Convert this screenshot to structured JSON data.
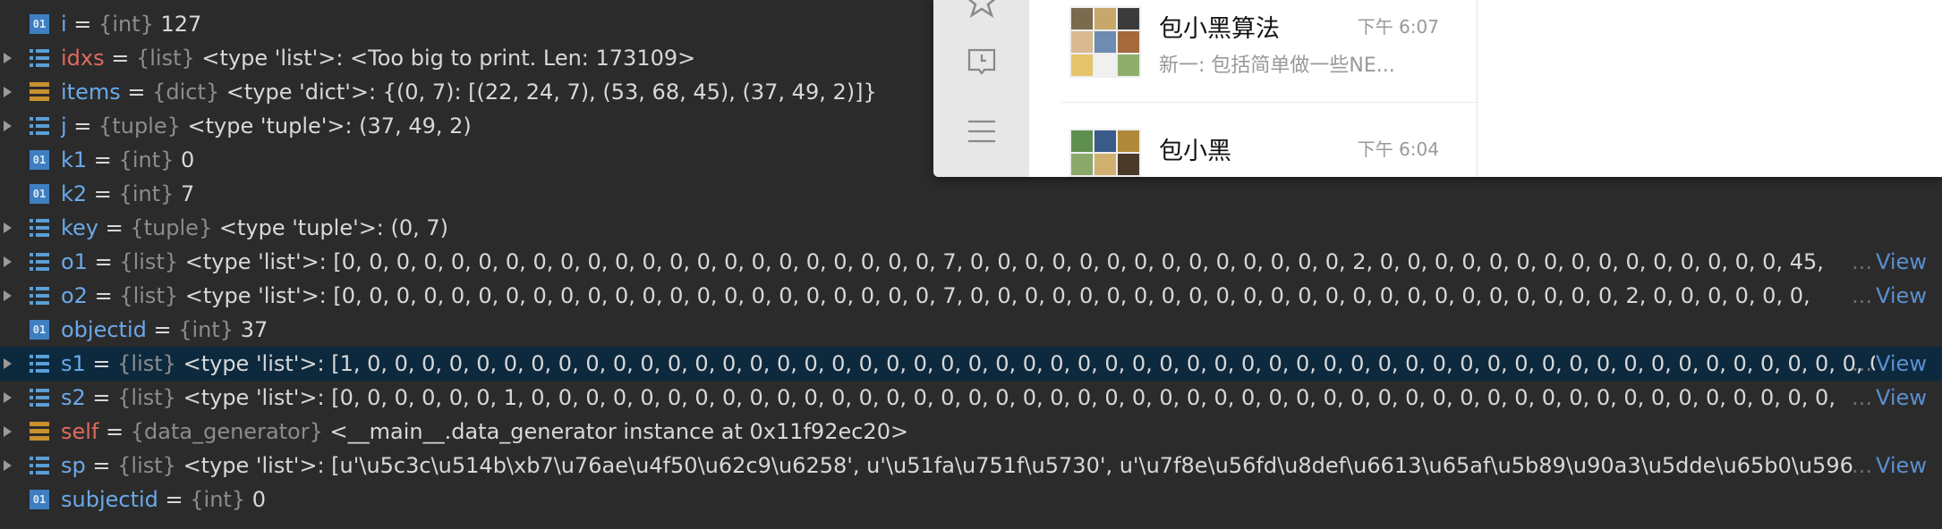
{
  "colors": {
    "background": "#2b2b2b",
    "selected_row": "#0d293e",
    "var_blue": "#6aa9e9",
    "var_red": "#e06a5f",
    "type_gray": "#8c8c8c",
    "value_text": "#d8d8d8",
    "view_link": "#5a8fd0"
  },
  "variables": [
    {
      "icon": "int-icon",
      "expandable": false,
      "name": "i",
      "name_color": "blue",
      "type": "{int}",
      "value": "127",
      "ellipsis": "",
      "view": ""
    },
    {
      "icon": "list-icon",
      "expandable": true,
      "name": "idxs",
      "name_color": "red",
      "type": "{list}",
      "value": "<type 'list'>: <Too big to print. Len: 173109>",
      "ellipsis": "",
      "view": ""
    },
    {
      "icon": "dict-icon",
      "expandable": true,
      "name": "items",
      "name_color": "blue",
      "type": "{dict}",
      "value": "<type 'dict'>: {(0, 7): [(22, 24, 7), (53, 68, 45), (37, 49, 2)]}",
      "ellipsis": "",
      "view": ""
    },
    {
      "icon": "list-icon",
      "expandable": true,
      "name": "j",
      "name_color": "blue",
      "type": "{tuple}",
      "value": "<type 'tuple'>: (37, 49, 2)",
      "ellipsis": "",
      "view": ""
    },
    {
      "icon": "int-icon",
      "expandable": false,
      "name": "k1",
      "name_color": "blue",
      "type": "{int}",
      "value": "0",
      "ellipsis": "",
      "view": ""
    },
    {
      "icon": "int-icon",
      "expandable": false,
      "name": "k2",
      "name_color": "blue",
      "type": "{int}",
      "value": "7",
      "ellipsis": "",
      "view": ""
    },
    {
      "icon": "list-icon",
      "expandable": true,
      "name": "key",
      "name_color": "blue",
      "type": "{tuple}",
      "value": "<type 'tuple'>: (0, 7)",
      "ellipsis": "",
      "view": ""
    },
    {
      "icon": "list-icon",
      "expandable": true,
      "name": "o1",
      "name_color": "blue",
      "type": "{list}",
      "value": "<type 'list'>: [0, 0, 0, 0, 0, 0, 0, 0, 0, 0, 0, 0, 0, 0, 0, 0, 0, 0, 0, 0, 0, 0, 7, 0, 0, 0, 0, 0, 0, 0, 0, 0, 0, 0, 0, 0, 0, 2, 0, 0, 0, 0, 0, 0, 0, 0, 0, 0, 0, 0, 0, 0, 0, 45,",
      "ellipsis": "...",
      "view": "View"
    },
    {
      "icon": "list-icon",
      "expandable": true,
      "name": "o2",
      "name_color": "blue",
      "type": "{list}",
      "value": "<type 'list'>: [0, 0, 0, 0, 0, 0, 0, 0, 0, 0, 0, 0, 0, 0, 0, 0, 0, 0, 0, 0, 0, 0, 7, 0, 0, 0, 0, 0, 0, 0, 0, 0, 0, 0, 0, 0, 0, 0, 0, 0, 0, 0, 0, 0, 0, 0, 0, 2, 0, 0, 0, 0, 0, 0,",
      "ellipsis": "...",
      "view": "View"
    },
    {
      "icon": "int-icon",
      "expandable": false,
      "name": "objectid",
      "name_color": "blue",
      "type": "{int}",
      "value": "37",
      "ellipsis": "",
      "view": ""
    },
    {
      "icon": "list-icon",
      "expandable": true,
      "name": "s1",
      "name_color": "blue",
      "type": "{list}",
      "value": "<type 'list'>: [1, 0, 0, 0, 0, 0, 0, 0, 0, 0, 0, 0, 0, 0, 0, 0, 0, 0, 0, 0, 0, 0, 0, 0, 0, 0, 0, 0, 0, 0, 0, 0, 0, 0, 0, 0, 0, 0, 0, 0, 0, 0, 0, 0, 0, 0, 0, 0, 0, 0, 0, 0, 0, 0, 0, 0, 0,",
      "ellipsis": "...",
      "view": "View",
      "selected": true
    },
    {
      "icon": "list-icon",
      "expandable": true,
      "name": "s2",
      "name_color": "blue",
      "type": "{list}",
      "value": "<type 'list'>: [0, 0, 0, 0, 0, 0, 1, 0, 0, 0, 0, 0, 0, 0, 0, 0, 0, 0, 0, 0, 0, 0, 0, 0, 0, 0, 0, 0, 0, 0, 0, 0, 0, 0, 0, 0, 0, 0, 0, 0, 0, 0, 0, 0, 0, 0, 0, 0, 0, 0, 0, 0, 0, 0, 0,",
      "ellipsis": "...",
      "view": "View"
    },
    {
      "icon": "dict-icon",
      "expandable": true,
      "name": "self",
      "name_color": "red",
      "type": "{data_generator}",
      "value": "<__main__.data_generator instance at 0x11f92ec20>",
      "ellipsis": "",
      "view": ""
    },
    {
      "icon": "list-icon",
      "expandable": true,
      "name": "sp",
      "name_color": "blue",
      "type": "{list}",
      "value": "<type 'list'>: [u'\\u5c3c\\u514b\\xb7\\u76ae\\u4f50\\u62c9\\u6258', u'\\u51fa\\u751f\\u5730', u'\\u7f8e\\u56fd\\u8def\\u6613\\u65af\\u5b89\\u90a3\\u5dde\\u65b0\\u596",
      "ellipsis": "...",
      "view": "View"
    },
    {
      "icon": "int-icon",
      "expandable": false,
      "name": "subjectid",
      "name_color": "blue",
      "type": "{int}",
      "value": "0",
      "ellipsis": "",
      "view": ""
    }
  ],
  "chat_window": {
    "chats": [
      {
        "name": "包小黑算法",
        "time": "下午 6:07",
        "preview": "新一: 包括简单做一些NE..."
      },
      {
        "name": "包小黑",
        "time": "下午 6:04",
        "preview": ""
      }
    ]
  }
}
